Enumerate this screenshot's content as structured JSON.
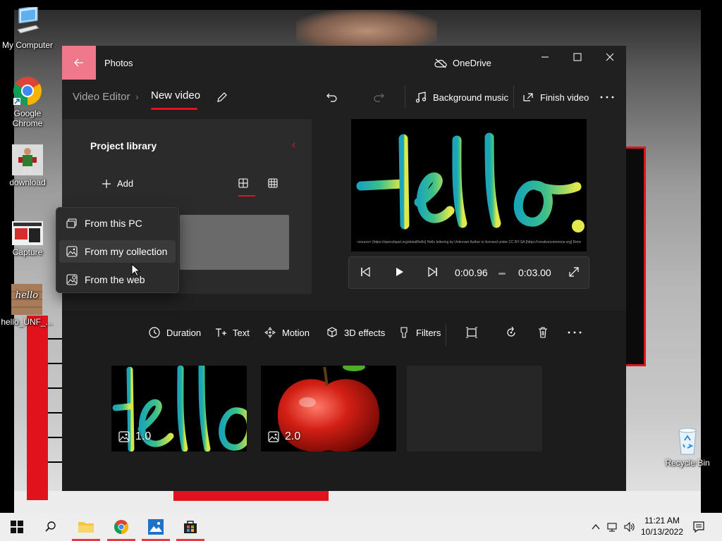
{
  "desktop": {
    "icons": [
      {
        "label": "My Computer"
      },
      {
        "label": "Google Chrome"
      },
      {
        "label": "download"
      },
      {
        "label": "Capture"
      },
      {
        "label": "hello_UNF_..."
      },
      {
        "label": "Recycle Bin"
      }
    ]
  },
  "window": {
    "title": "Photos",
    "cloud_status": "OneDrive"
  },
  "toolbar": {
    "breadcrumb_parent": "Video Editor",
    "breadcrumb_current": "New video",
    "background_music": "Background music",
    "finish_video": "Finish video"
  },
  "library": {
    "title": "Project library",
    "add_label": "Add"
  },
  "add_menu": {
    "items": [
      {
        "label": "From this PC"
      },
      {
        "label": "From my collection"
      },
      {
        "label": "From the web"
      }
    ],
    "hovered_index": 1
  },
  "preview": {
    "text": "Hello.",
    "caption": "<source> [https://openclipart.org/detail/hello] Hello lettering by Unknown Author is licensed under CC BY-SA [https://creativecommons.org] Remove by ICC 2.0"
  },
  "player": {
    "current_time": "0:00.96",
    "total_time": "0:03.00"
  },
  "storyboard": {
    "tools": {
      "duration": "Duration",
      "text": "Text",
      "motion": "Motion",
      "effects_3d": "3D effects",
      "filters": "Filters"
    },
    "clips": [
      {
        "duration": "1.0",
        "content": "hello-text"
      },
      {
        "duration": "2.0",
        "content": "apple"
      }
    ]
  },
  "taskbar": {
    "time": "11:21 AM",
    "date": "10/13/2022"
  },
  "colors": {
    "accent": "#e81123",
    "back_button": "#f0788b",
    "window_bg": "#202020",
    "panel_bg": "#2b2b2b"
  }
}
